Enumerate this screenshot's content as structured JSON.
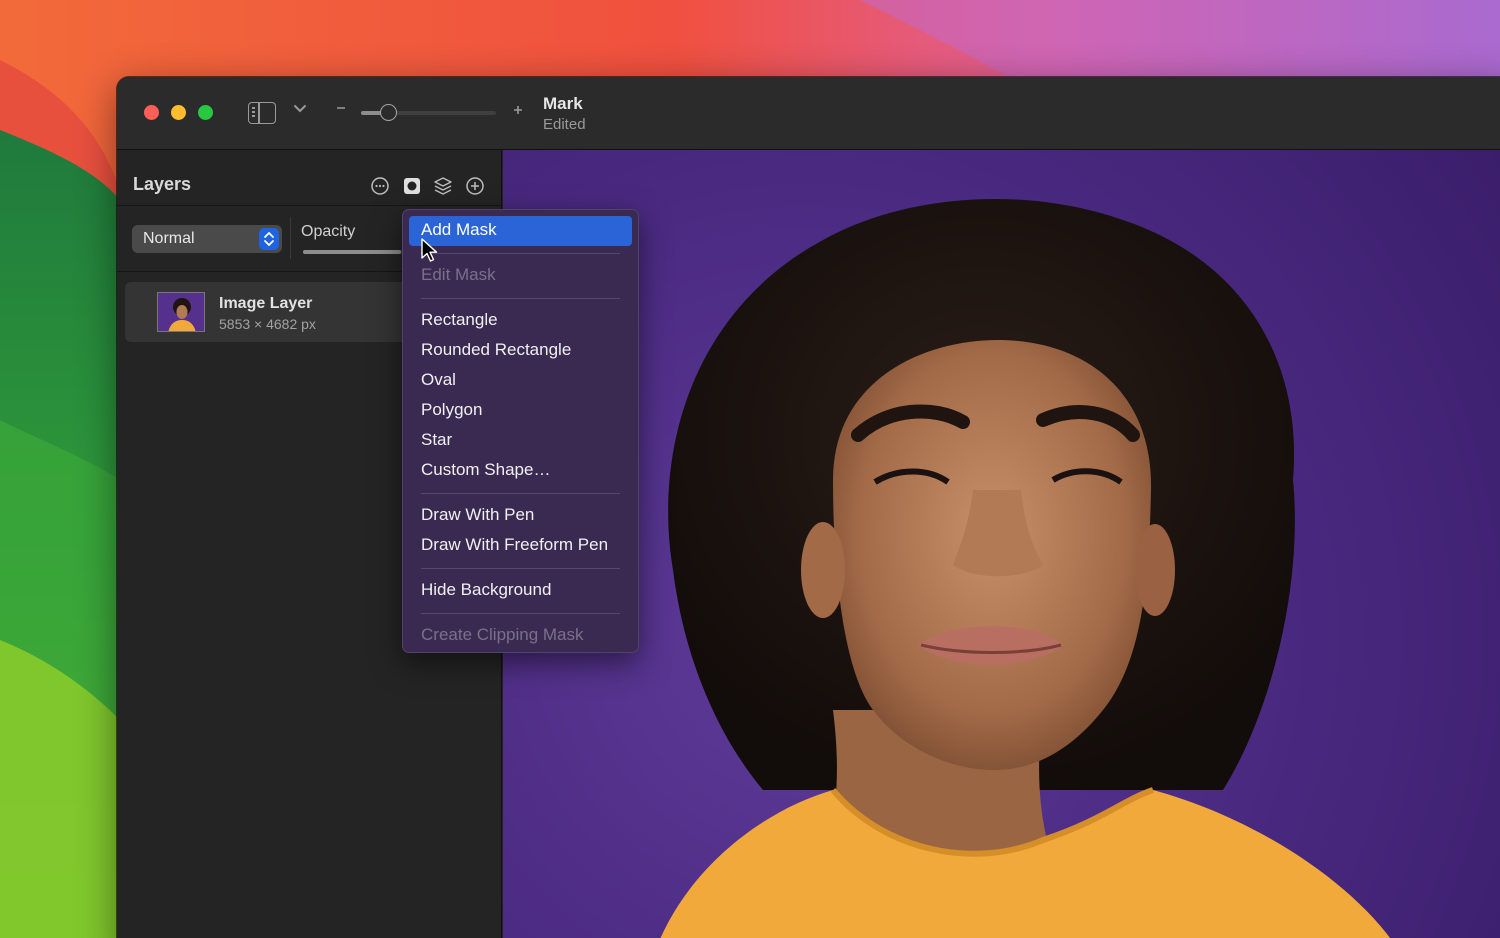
{
  "window": {
    "title": "Mark",
    "subtitle": "Edited",
    "zoom_level": 0.2
  },
  "layers_panel": {
    "title": "Layers",
    "blend_mode": "Normal",
    "opacity_label": "Opacity",
    "opacity_value": 0.49,
    "layers": [
      {
        "name": "Image Layer",
        "dimensions": "5853 × 4682 px"
      }
    ]
  },
  "context_menu": {
    "items": [
      {
        "label": "Add Mask",
        "state": "highlighted"
      },
      {
        "label": "Edit Mask",
        "state": "disabled"
      },
      {
        "label": "Rectangle",
        "state": "enabled"
      },
      {
        "label": "Rounded Rectangle",
        "state": "enabled"
      },
      {
        "label": "Oval",
        "state": "enabled"
      },
      {
        "label": "Polygon",
        "state": "enabled"
      },
      {
        "label": "Star",
        "state": "enabled"
      },
      {
        "label": "Custom Shape…",
        "state": "enabled"
      },
      {
        "label": "Draw With Pen",
        "state": "enabled"
      },
      {
        "label": "Draw With Freeform Pen",
        "state": "enabled"
      },
      {
        "label": "Hide Background",
        "state": "enabled"
      },
      {
        "label": "Create Clipping Mask",
        "state": "disabled"
      }
    ]
  },
  "colors": {
    "accent": "#2a64d6",
    "canvas_background": "#4d2c85",
    "shirt": "#f2a93b"
  }
}
